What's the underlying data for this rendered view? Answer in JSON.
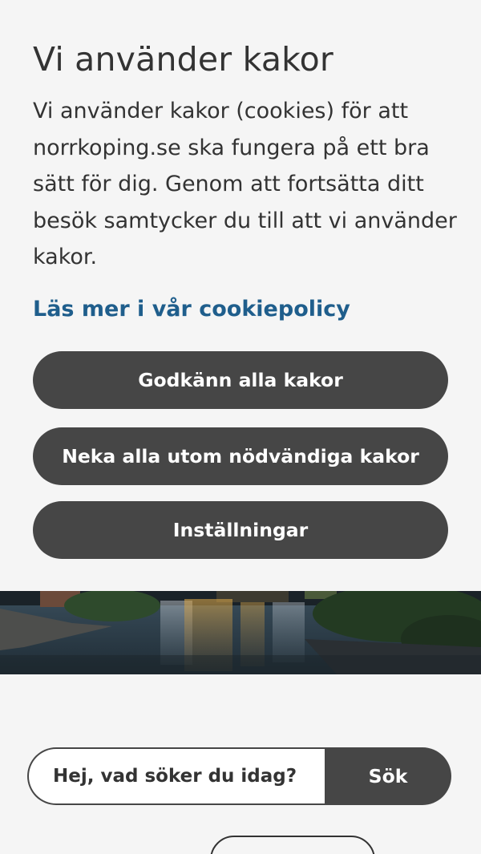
{
  "cookie_banner": {
    "title": "Vi använder kakor",
    "text": "Vi använder kakor (cookies) för att norrkoping.se ska fungera på ett bra sätt för dig. Genom att fortsätta ditt besök samtycker du till att vi använder kakor.",
    "policy_link": "Läs mer i vår cookiepolicy",
    "accept_label": "Godkänn alla kakor",
    "reject_label": "Neka alla utom nödvändiga kakor",
    "settings_label": "Inställningar"
  },
  "search": {
    "placeholder": "Hej, vad söker du idag?",
    "button_label": "Sök"
  },
  "colors": {
    "background": "#f5f5f5",
    "button": "#464646",
    "link": "#1f5e8c"
  }
}
